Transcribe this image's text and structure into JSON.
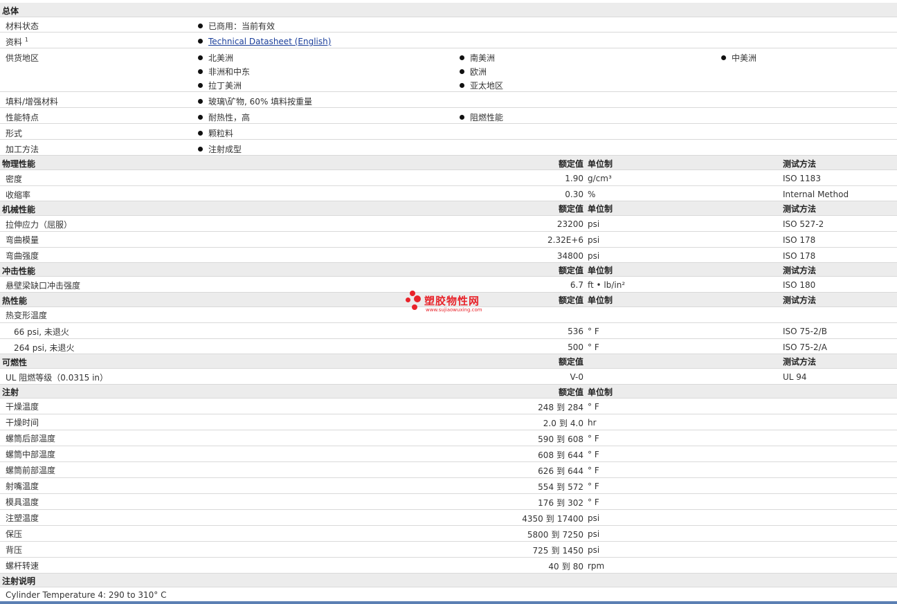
{
  "general": {
    "header": "总体",
    "status_label": "材料状态",
    "status_value": "已商用：当前有效",
    "docs_label": "资料",
    "docs_sup": "1",
    "docs_link": "Technical Datasheet (English)",
    "regions_label": "供货地区",
    "regions": [
      "北美洲",
      "南美洲",
      "中美洲",
      "非洲和中东",
      "欧洲",
      "拉丁美洲",
      "亚太地区"
    ],
    "filler_label": "填料/增强材料",
    "filler_value": "玻璃\\矿物, 60% 填料按重量",
    "features_label": "性能特点",
    "features": [
      "耐热性，高",
      "阻燃性能"
    ],
    "form_label": "形式",
    "form_value": "颗粒料",
    "process_label": "加工方法",
    "process_value": "注射成型"
  },
  "columns": {
    "value": "额定值",
    "unit": "单位制",
    "method": "测试方法"
  },
  "physical": {
    "header": "物理性能",
    "rows": [
      {
        "name": "密度",
        "value": "1.90",
        "unit": "g/cm³",
        "method": "ISO 1183"
      },
      {
        "name": "收缩率",
        "value": "0.30",
        "unit": "%",
        "method": "Internal Method"
      }
    ]
  },
  "mechanical": {
    "header": "机械性能",
    "rows": [
      {
        "name": "拉伸应力（屈服）",
        "value": "23200",
        "unit": "psi",
        "method": "ISO 527-2"
      },
      {
        "name": "弯曲模量",
        "value": "2.32E+6",
        "unit": "psi",
        "method": "ISO 178"
      },
      {
        "name": "弯曲强度",
        "value": "34800",
        "unit": "psi",
        "method": "ISO 178"
      }
    ]
  },
  "impact": {
    "header": "冲击性能",
    "rows": [
      {
        "name": "悬壁梁缺口冲击强度",
        "value": "6.7",
        "unit": "ft • lb/in²",
        "method": "ISO 180"
      }
    ]
  },
  "thermal": {
    "header": "热性能",
    "group": "热变形温度",
    "rows": [
      {
        "name": "66 psi, 未退火",
        "value": "536",
        "unit": "° F",
        "method": "ISO 75-2/B"
      },
      {
        "name": "264 psi, 未退火",
        "value": "500",
        "unit": "° F",
        "method": "ISO 75-2/A"
      }
    ]
  },
  "flammability": {
    "header": "可燃性",
    "rows": [
      {
        "name": "UL 阻燃等级（0.0315 in）",
        "value": "V-0",
        "method": "UL 94"
      }
    ]
  },
  "injection": {
    "header": "注射",
    "range_word": "到",
    "rows": [
      {
        "name": "干燥温度",
        "from": "248",
        "to": "284",
        "unit": "° F"
      },
      {
        "name": "干燥时间",
        "from": "2.0",
        "to": "4.0",
        "unit": "hr"
      },
      {
        "name": "螺筒后部温度",
        "from": "590",
        "to": "608",
        "unit": "° F"
      },
      {
        "name": "螺筒中部温度",
        "from": "608",
        "to": "644",
        "unit": "° F"
      },
      {
        "name": "螺筒前部温度",
        "from": "626",
        "to": "644",
        "unit": "° F"
      },
      {
        "name": "射嘴温度",
        "from": "554",
        "to": "572",
        "unit": "° F"
      },
      {
        "name": "模具温度",
        "from": "176",
        "to": "302",
        "unit": "° F"
      },
      {
        "name": "注塑温度",
        "from": "4350",
        "to": "17400",
        "unit": "psi"
      },
      {
        "name": "保压",
        "from": "5800",
        "to": "7250",
        "unit": "psi"
      },
      {
        "name": "背压",
        "from": "725",
        "to": "1450",
        "unit": "psi"
      },
      {
        "name": "螺杆转速",
        "from": "40",
        "to": "80",
        "unit": "rpm"
      }
    ]
  },
  "notes": {
    "header": "注射说明",
    "text": "Cylinder Temperature 4: 290 to 310° C"
  },
  "watermark": {
    "title": "塑胶物性网",
    "url": "www.sujiaowuxing.com",
    "color": "#e8232a"
  }
}
